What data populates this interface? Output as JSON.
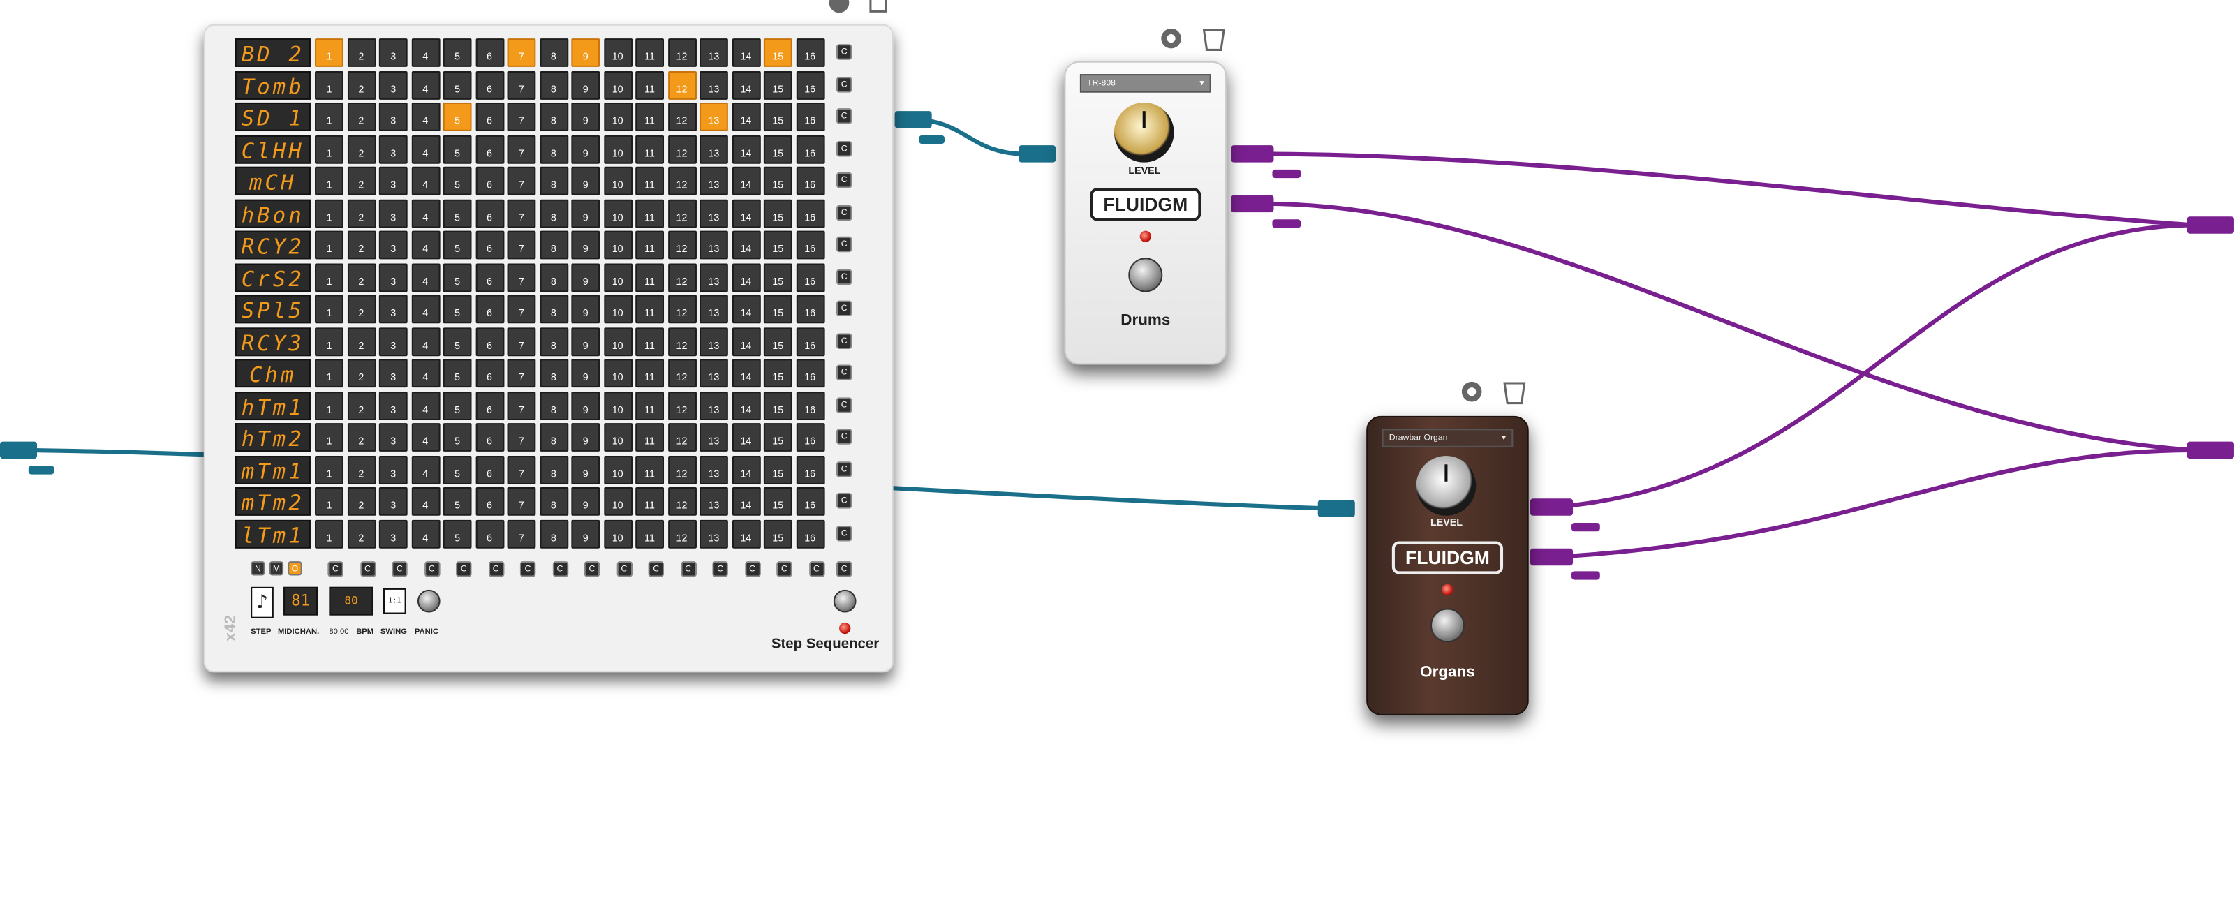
{
  "sequencer": {
    "title": "Step Sequencer",
    "brand_vertical": "x42",
    "tracks": [
      {
        "name": "BD 2",
        "active": [
          1,
          7,
          9,
          15
        ]
      },
      {
        "name": "Tomb",
        "active": [
          12
        ]
      },
      {
        "name": "SD 1",
        "active": [
          5,
          13
        ]
      },
      {
        "name": "ClHH",
        "active": []
      },
      {
        "name": "mCH",
        "active": []
      },
      {
        "name": "hBon",
        "active": []
      },
      {
        "name": "RCY2",
        "active": []
      },
      {
        "name": "CrS2",
        "active": []
      },
      {
        "name": "SPl5",
        "active": []
      },
      {
        "name": "RCY3",
        "active": []
      },
      {
        "name": "Chm",
        "active": []
      },
      {
        "name": "hTm1",
        "active": []
      },
      {
        "name": "hTm2",
        "active": []
      },
      {
        "name": "mTm1",
        "active": []
      },
      {
        "name": "mTm2",
        "active": []
      },
      {
        "name": "lTm1",
        "active": []
      }
    ],
    "steps": [
      "1",
      "2",
      "3",
      "4",
      "5",
      "6",
      "7",
      "8",
      "9",
      "10",
      "11",
      "12",
      "13",
      "14",
      "15",
      "16"
    ],
    "clear_label": "C",
    "mode_buttons": [
      "N",
      "M",
      "O"
    ],
    "bottom_labels": {
      "step": "STEP",
      "midichan": "MIDICHAN.",
      "bpm_value": "80.00",
      "bpm": "BPM",
      "swing": "SWING",
      "panic": "PANIC",
      "swing_value": "1:1",
      "bpm_display": "80"
    }
  },
  "pedals": [
    {
      "preset": "TR-808",
      "level_label": "LEVEL",
      "brand": "FLUIDGM",
      "name": "Drums",
      "theme": "white"
    },
    {
      "preset": "Drawbar Organ",
      "level_label": "LEVEL",
      "brand": "FLUIDGM",
      "name": "Organs",
      "theme": "brown"
    }
  ],
  "colors": {
    "step_active": "#f39a1a",
    "cable_midi": "#1a6f8a",
    "cable_audio": "#7a1f8f"
  }
}
